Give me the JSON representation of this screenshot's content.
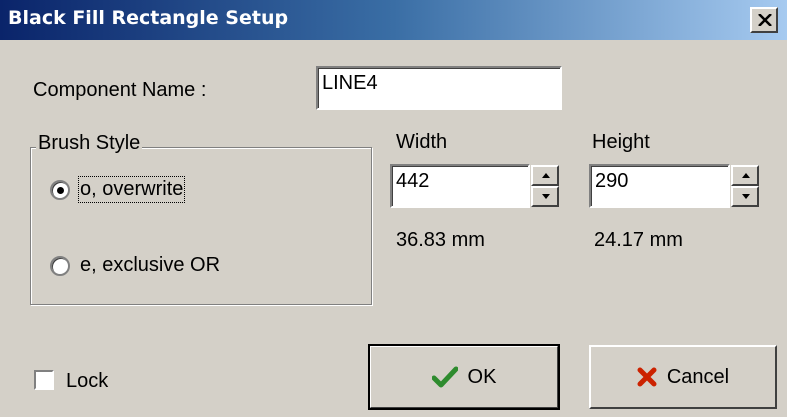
{
  "window": {
    "title": "Black Fill Rectangle Setup",
    "close_icon": "close-icon"
  },
  "component_name": {
    "label": "Component Name :",
    "value": "LINE4"
  },
  "brush_style": {
    "legend": "Brush Style",
    "options": [
      {
        "label": "o, overwrite",
        "selected": true
      },
      {
        "label": "e, exclusive OR",
        "selected": false
      }
    ]
  },
  "width": {
    "label": "Width",
    "value": "442",
    "mm": "36.83 mm"
  },
  "height": {
    "label": "Height",
    "value": "290",
    "mm": "24.17 mm"
  },
  "lock": {
    "label": "Lock",
    "checked": false
  },
  "buttons": {
    "ok": {
      "label": "OK",
      "icon": "check-icon",
      "color": "#2e8b2e"
    },
    "cancel": {
      "label": "Cancel",
      "icon": "x-icon",
      "color": "#cc2200"
    }
  }
}
